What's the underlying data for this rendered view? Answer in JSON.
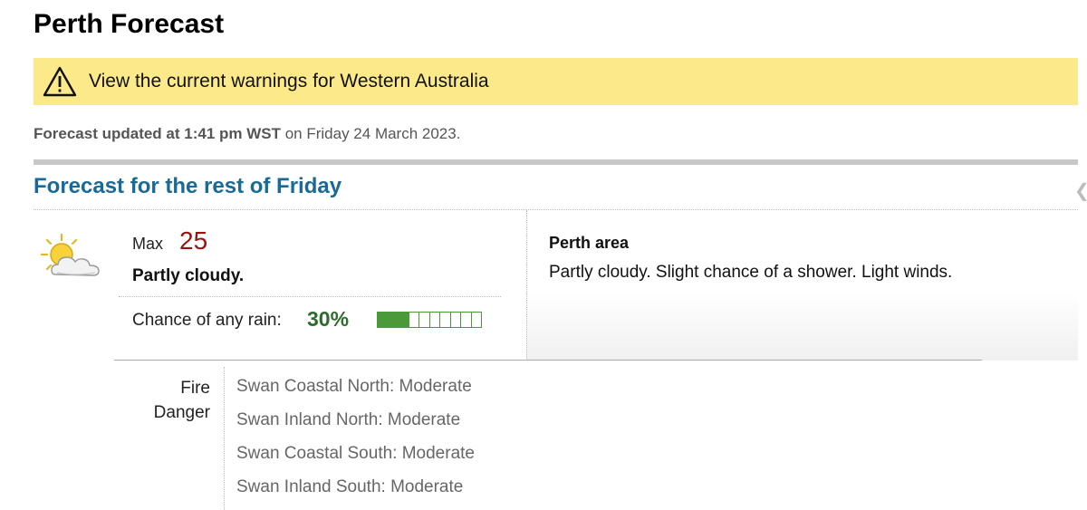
{
  "page": {
    "title": "Perth Forecast"
  },
  "warning": {
    "text": "View the current warnings for Western Australia",
    "icon": "warning-triangle-icon",
    "background": "#fbe98a"
  },
  "updated": {
    "prefix": "Forecast updated at 1:41 pm WST",
    "suffix": " on Friday 24 March 2023."
  },
  "section": {
    "title": "Forecast for the rest of Friday"
  },
  "forecast": {
    "icon": "partly-cloudy-icon",
    "max_label": "Max",
    "max_value": "25",
    "summary": "Partly cloudy.",
    "rain_label": "Chance of any rain:",
    "rain_value": "30%",
    "rain_meter": {
      "filled": 3,
      "total": 10
    }
  },
  "area": {
    "title": "Perth area",
    "text": "Partly cloudy. Slight chance of a shower. Light winds."
  },
  "fire_danger": {
    "label_line1": "Fire",
    "label_line2": "Danger",
    "items": [
      "Swan Coastal North: Moderate",
      "Swan Inland North: Moderate",
      "Swan Coastal South: Moderate",
      "Swan Inland South: Moderate"
    ]
  },
  "colors": {
    "section_title": "#1a6a96",
    "max_value": "#a01010",
    "rain_value": "#2e6b2e",
    "rain_meter": "#4a9a3a"
  }
}
